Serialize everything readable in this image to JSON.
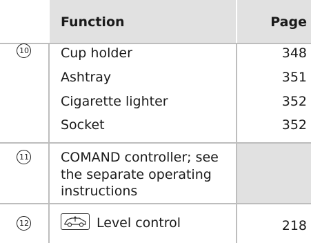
{
  "header": {
    "function": "Function",
    "page": "Page"
  },
  "rows": [
    {
      "num": "10",
      "items": [
        {
          "label": "Cup holder",
          "page": "348"
        },
        {
          "label": "Ashtray",
          "page": "351"
        },
        {
          "label": "Cigarette lighter",
          "page": "352"
        },
        {
          "label": "Socket",
          "page": "352"
        }
      ]
    },
    {
      "num": "11",
      "text_lines": [
        "COMAND controller; see",
        "the separate operating",
        "instructions"
      ],
      "page": ""
    },
    {
      "num": "12",
      "label": "Level control",
      "page": "218",
      "icon": "level-control-icon"
    }
  ]
}
